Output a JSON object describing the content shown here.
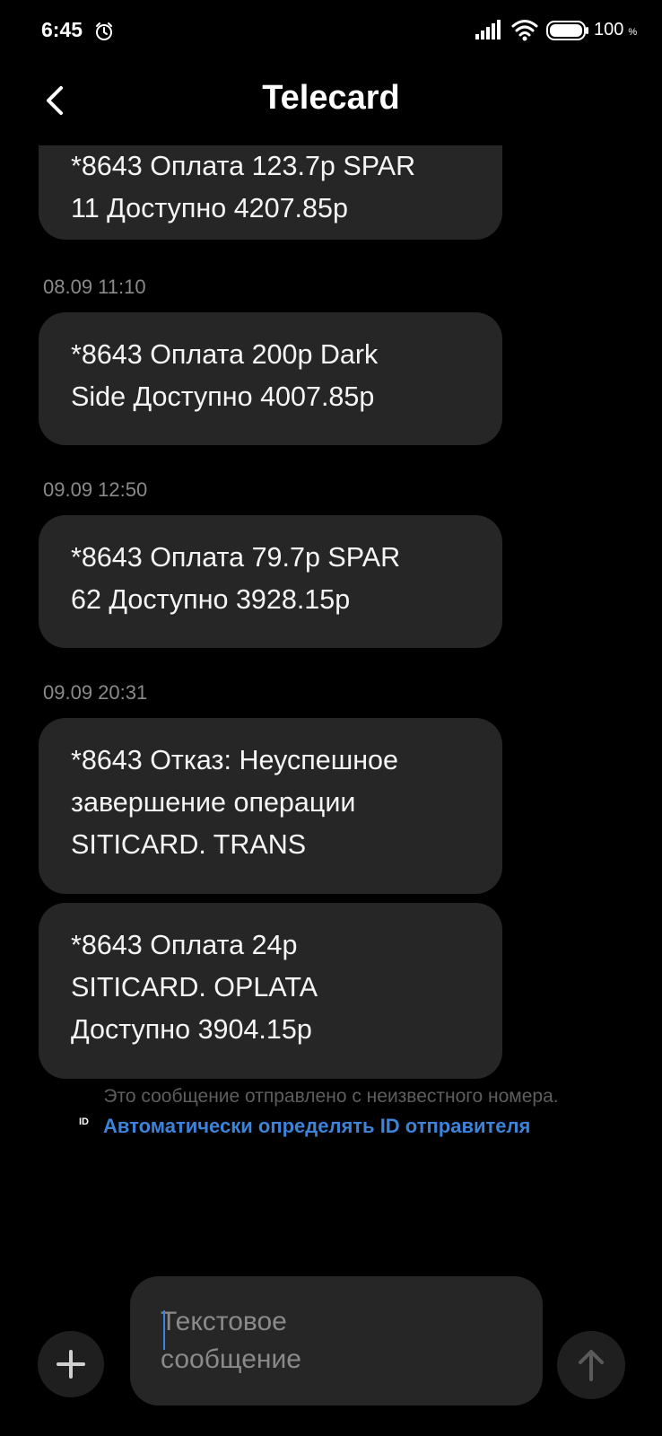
{
  "status_bar": {
    "time": "6:45",
    "battery_level": "100",
    "battery_unit": "%",
    "icons": [
      "alarm-icon",
      "signal-icon",
      "wifi-icon",
      "battery-icon"
    ]
  },
  "header": {
    "title": "Telecard",
    "back_icon": "back-arrow-icon"
  },
  "messages": [
    {
      "timestamp": "",
      "text": "*8643 Оплата 123.7р SPAR\n11 Доступно 4207.85р"
    },
    {
      "timestamp": "08.09 11:10",
      "text": "*8643 Оплата 200р Dark\nSide Доступно 4007.85р"
    },
    {
      "timestamp": "09.09 12:50",
      "text": "*8643 Оплата 79.7р SPAR\n62 Доступно 3928.15р"
    },
    {
      "timestamp": "09.09 20:31",
      "text": "*8643 Отказ: Неуспешное\nзавершение операции\nSITICARD. TRANS"
    },
    {
      "timestamp": "",
      "text": "*8643 Оплата 24р\nSITICARD. OPLATA\nДоступно 3904.15р"
    }
  ],
  "notice": {
    "unknown_sender": "Это сообщение отправлено с неизвестного номера.",
    "id_badge": "ID",
    "auto_id_link": "Автоматически определять ID отправителя"
  },
  "composer": {
    "placeholder": "Текстовое\nсообщение",
    "add_icon": "plus-icon",
    "send_icon": "send-arrow-icon"
  },
  "colors": {
    "background": "#000000",
    "bubble": "#262626",
    "link": "#3d83d9",
    "timestamp": "#8a8a8a"
  }
}
